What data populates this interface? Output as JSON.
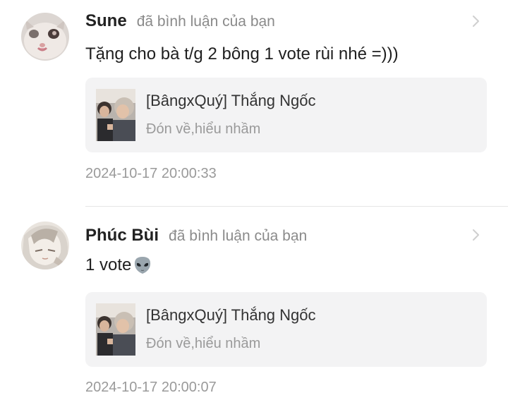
{
  "notifications": [
    {
      "username": "Sune",
      "action": "đã bình luận của bạn",
      "comment": "Tặng cho bà t/g 2 bông 1 vote rùi nhé =)))",
      "story_title": "[BângxQuý] Thắng Ngốc",
      "story_subtitle": "Đón về,hiểu nhầm",
      "timestamp": "2024-10-17 20:00:33",
      "avatar_icon": "cat-avatar-icon"
    },
    {
      "username": "Phúc Bùi",
      "action": "đã bình luận của bạn",
      "comment": "1 vote",
      "comment_emoji": "alien-emoji-icon",
      "story_title": "[BângxQuý] Thắng Ngốc",
      "story_subtitle": "Đón về,hiểu nhầm",
      "timestamp": "2024-10-17 20:00:07",
      "avatar_icon": "anime-avatar-icon"
    }
  ],
  "colors": {
    "card_bg": "#f3f3f4",
    "muted_text": "#9a9a9a",
    "divider": "#e6e6e6"
  }
}
